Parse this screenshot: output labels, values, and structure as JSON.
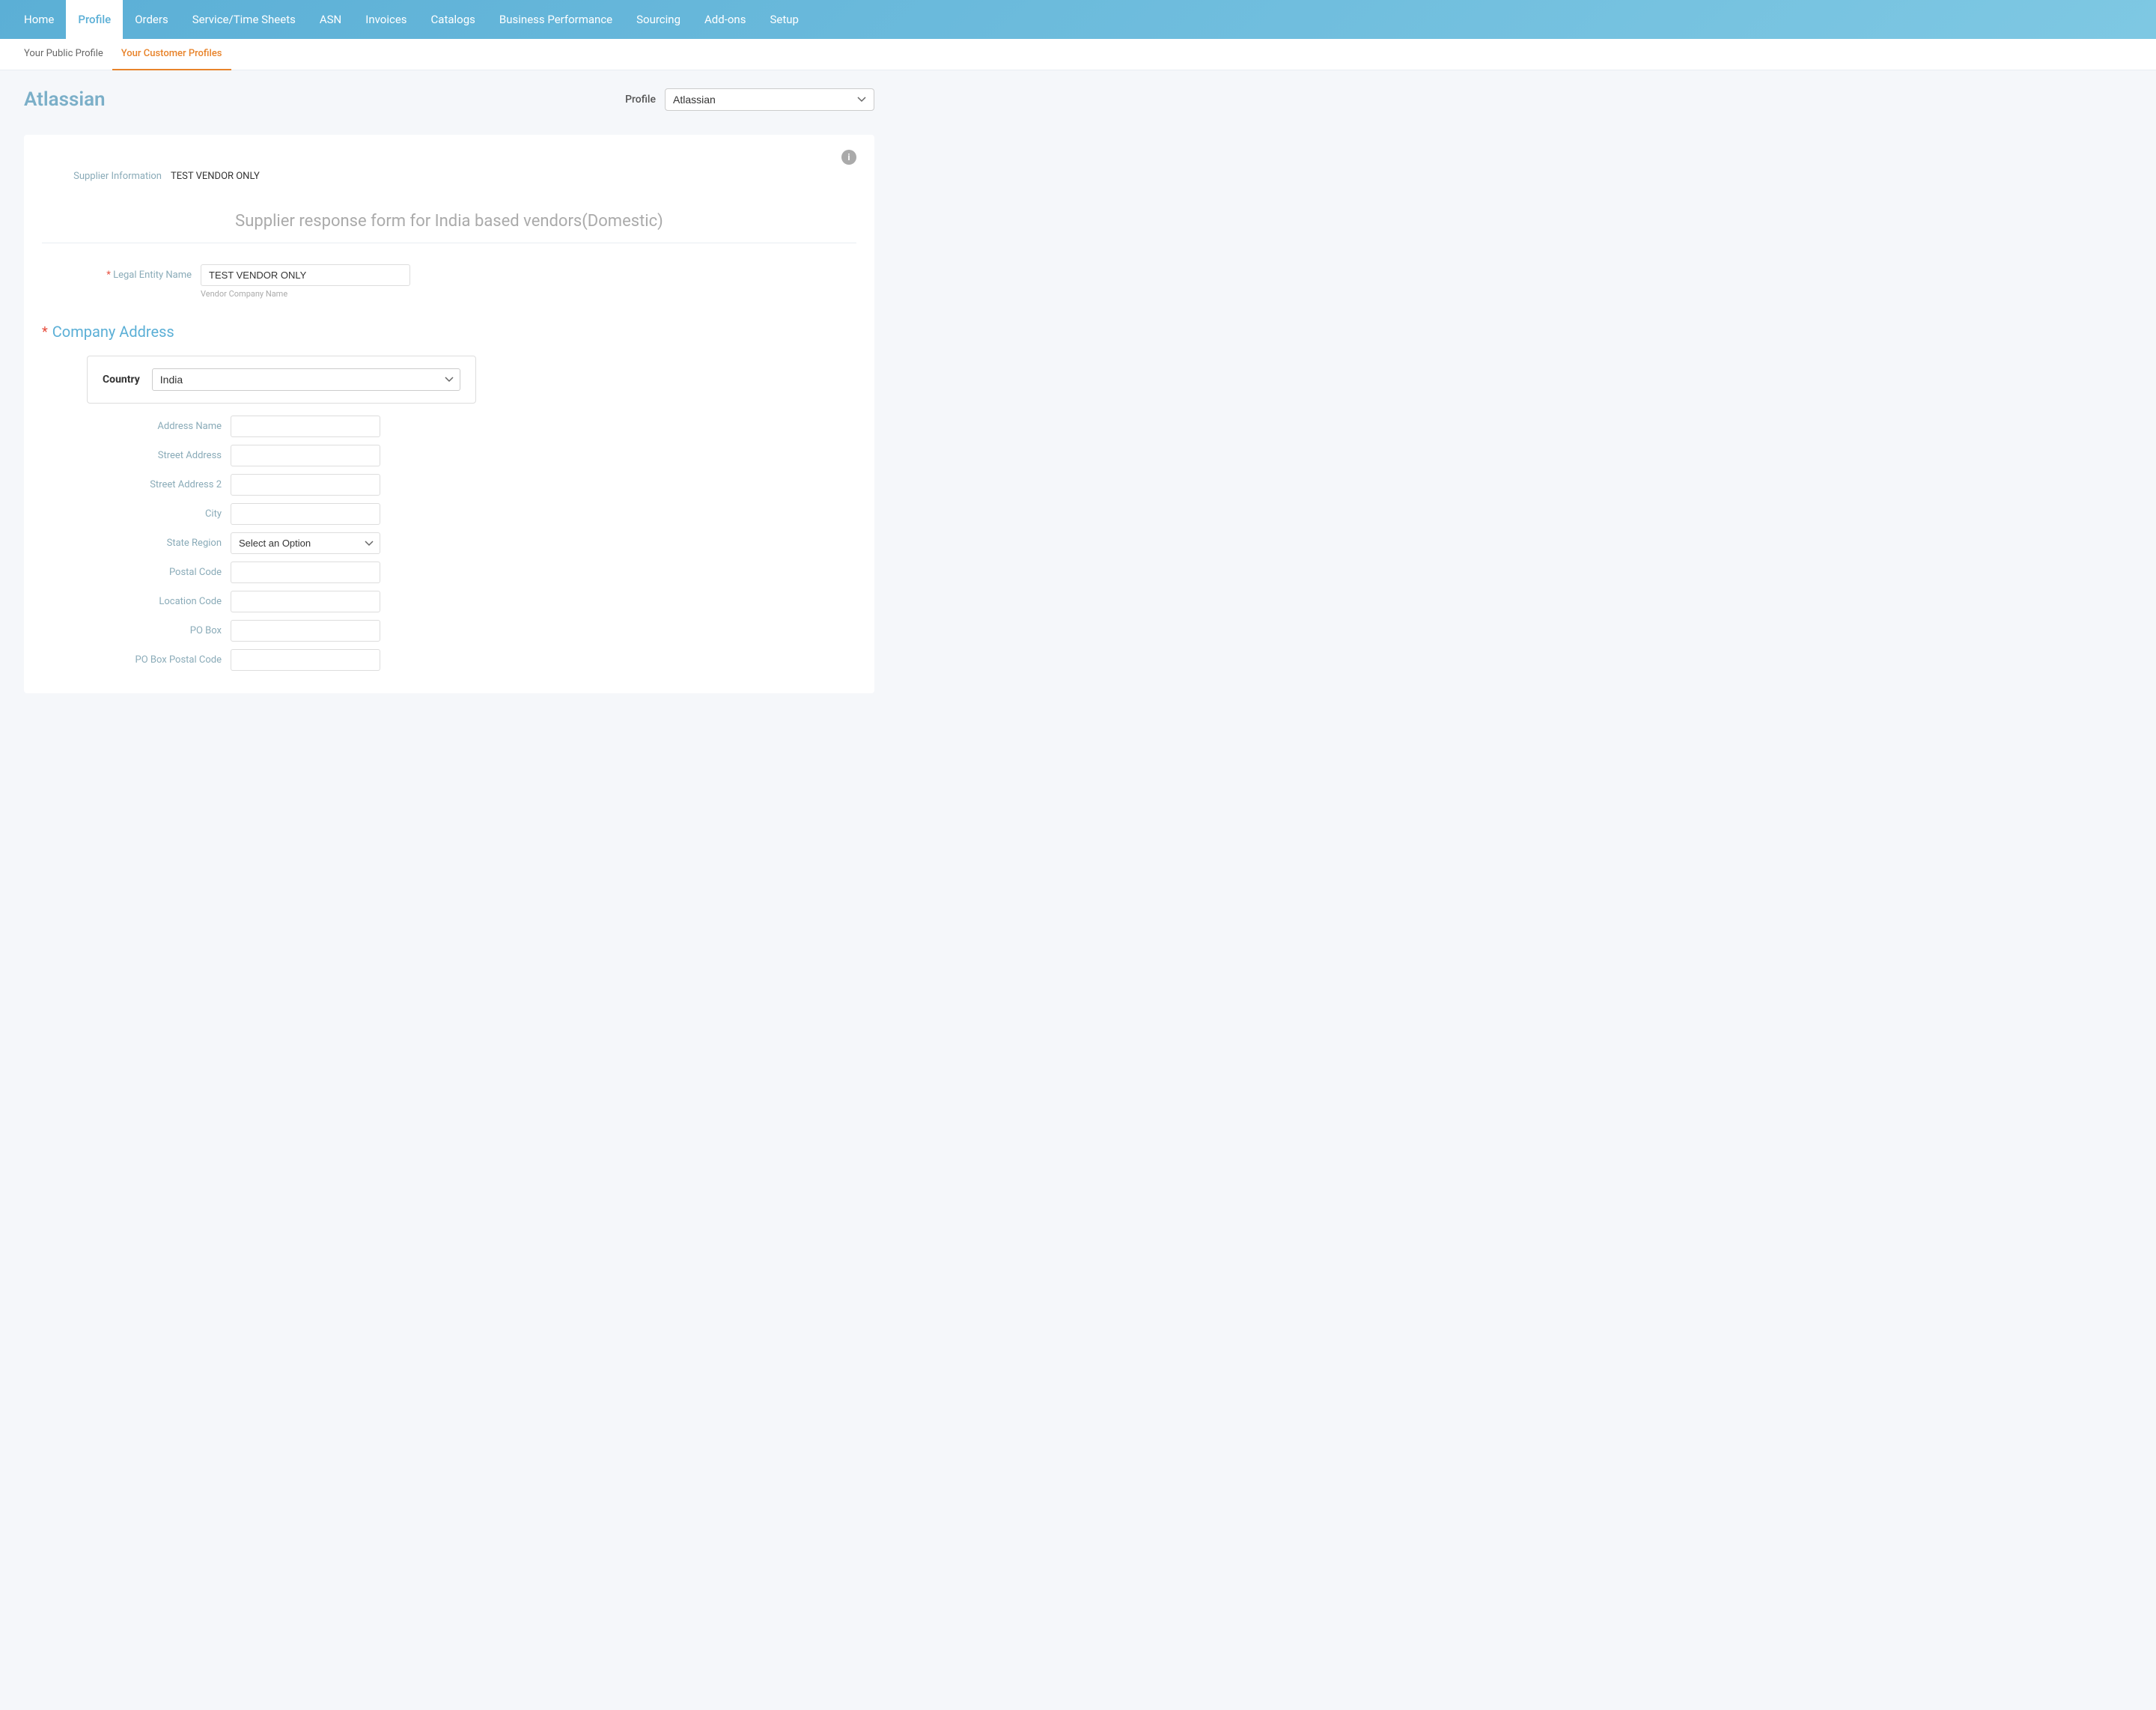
{
  "nav": {
    "items": [
      {
        "label": "Home",
        "active": false
      },
      {
        "label": "Profile",
        "active": true
      },
      {
        "label": "Orders",
        "active": false
      },
      {
        "label": "Service/Time Sheets",
        "active": false
      },
      {
        "label": "ASN",
        "active": false
      },
      {
        "label": "Invoices",
        "active": false
      },
      {
        "label": "Catalogs",
        "active": false
      },
      {
        "label": "Business Performance",
        "active": false
      },
      {
        "label": "Sourcing",
        "active": false
      },
      {
        "label": "Add-ons",
        "active": false
      },
      {
        "label": "Setup",
        "active": false
      }
    ]
  },
  "subnav": {
    "items": [
      {
        "label": "Your Public Profile",
        "active": false
      },
      {
        "label": "Your Customer Profiles",
        "active": true
      }
    ]
  },
  "page": {
    "company_name": "Atlassian",
    "profile_label": "Profile",
    "profile_value": "Atlassian",
    "supplier_info_label": "Supplier Information",
    "supplier_info_value": "TEST VENDOR ONLY",
    "form_title": "Supplier response form for India based vendors(Domestic)",
    "legal_entity_name_label": "Legal Entity Name",
    "legal_entity_name_required": true,
    "legal_entity_name_value": "TEST VENDOR ONLY",
    "legal_entity_name_hint": "Vendor Company Name",
    "company_address_label": "Company Address",
    "country_label": "Country",
    "country_value": "India",
    "address_fields": [
      {
        "label": "Address Name",
        "type": "input",
        "value": "",
        "placeholder": ""
      },
      {
        "label": "Street Address",
        "type": "input",
        "value": "",
        "placeholder": ""
      },
      {
        "label": "Street Address 2",
        "type": "input",
        "value": "",
        "placeholder": ""
      },
      {
        "label": "City",
        "type": "input",
        "value": "",
        "placeholder": ""
      },
      {
        "label": "State Region",
        "type": "select",
        "value": "",
        "placeholder": "Select an Option"
      },
      {
        "label": "Postal Code",
        "type": "input",
        "value": "",
        "placeholder": ""
      },
      {
        "label": "Location Code",
        "type": "input",
        "value": "",
        "placeholder": ""
      },
      {
        "label": "PO Box",
        "type": "input",
        "value": "",
        "placeholder": ""
      },
      {
        "label": "PO Box Postal Code",
        "type": "input",
        "value": "",
        "placeholder": ""
      }
    ]
  }
}
